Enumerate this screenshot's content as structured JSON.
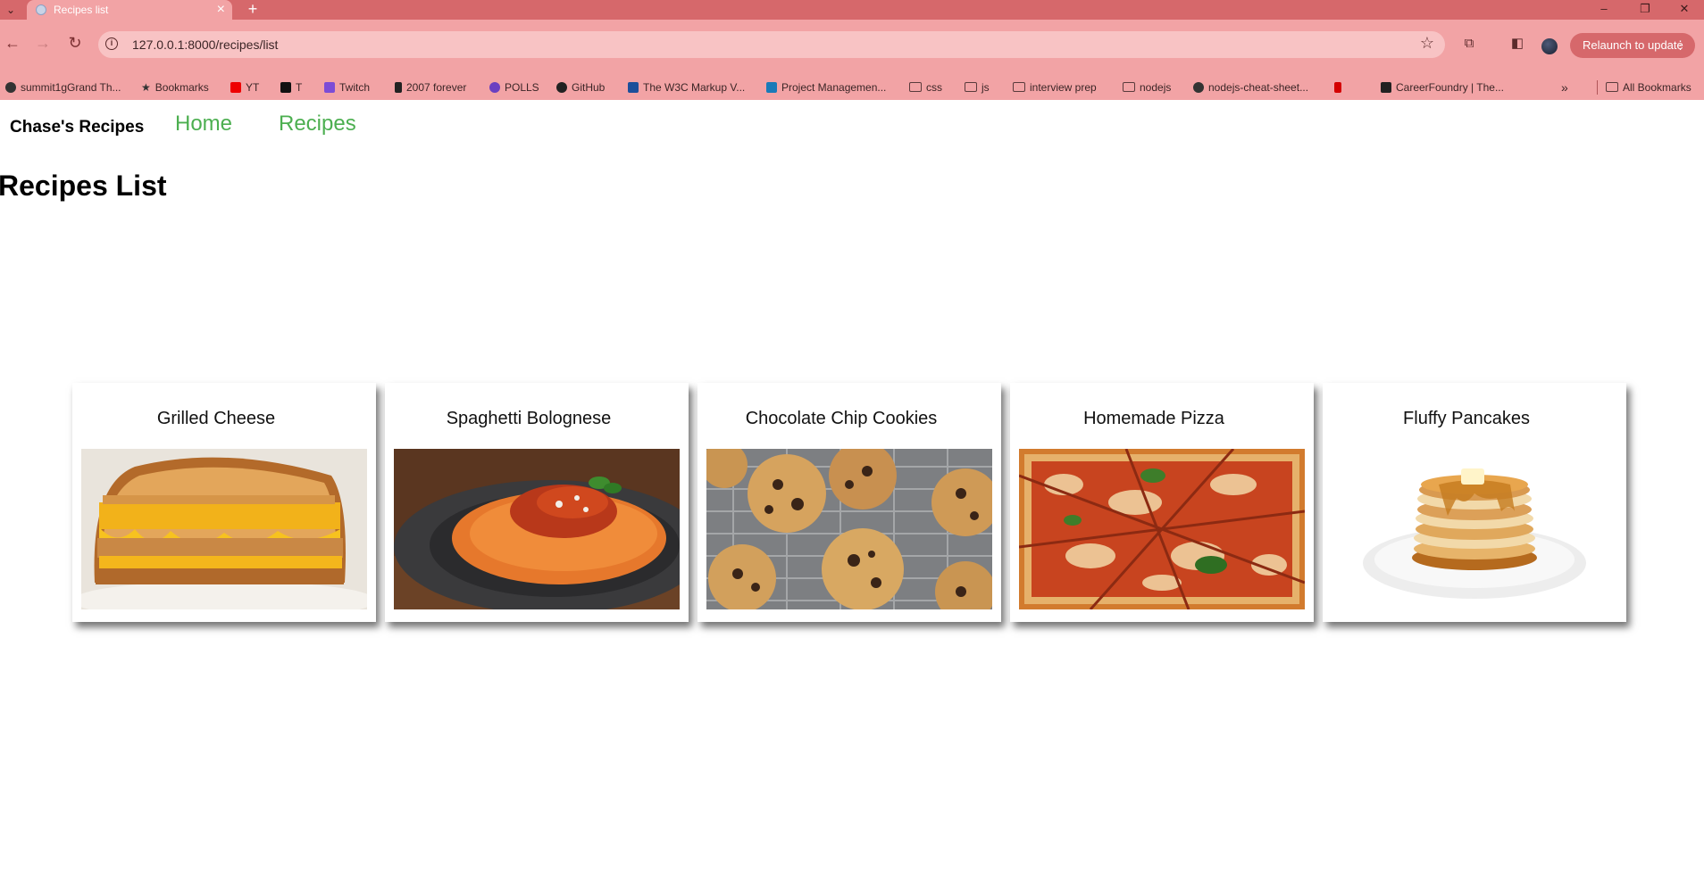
{
  "browser": {
    "tab_title": "Recipes list",
    "new_tab": "+",
    "url": "127.0.0.1:8000/recipes/list",
    "relaunch_label": "Relaunch to update",
    "bookmarks": [
      {
        "label": "summit1gGrand Th...",
        "icon": "globe-icon"
      },
      {
        "label": "Bookmarks",
        "icon": "star-icon"
      },
      {
        "label": "YT",
        "icon": "youtube-icon"
      },
      {
        "label": "T",
        "icon": "x-icon"
      },
      {
        "label": "Twitch",
        "icon": "twitch-icon"
      },
      {
        "label": "2007 forever",
        "icon": "page-icon"
      },
      {
        "label": "POLLS",
        "icon": "polls-icon"
      },
      {
        "label": "GitHub",
        "icon": "github-icon"
      },
      {
        "label": "The W3C Markup V...",
        "icon": "w3c-icon"
      },
      {
        "label": "Project Managemen...",
        "icon": "trello-icon"
      },
      {
        "label": "css",
        "icon": "folder-icon"
      },
      {
        "label": "js",
        "icon": "folder-icon"
      },
      {
        "label": "interview prep",
        "icon": "folder-icon"
      },
      {
        "label": "nodejs",
        "icon": "folder-icon"
      },
      {
        "label": "nodejs-cheat-sheet...",
        "icon": "globe-icon"
      },
      {
        "label": "",
        "icon": "netflix-icon"
      },
      {
        "label": "CareerFoundry | The...",
        "icon": "careerfoundry-icon"
      }
    ],
    "all_bookmarks": "All Bookmarks"
  },
  "site": {
    "brand": "Chase's Recipes",
    "nav": [
      "Home",
      "Recipes"
    ]
  },
  "page": {
    "title": "Recipes List"
  },
  "recipes": [
    {
      "name": "Grilled Cheese"
    },
    {
      "name": "Spaghetti Bolognese"
    },
    {
      "name": "Chocolate Chip Cookies"
    },
    {
      "name": "Homemade Pizza"
    },
    {
      "name": "Fluffy Pancakes"
    }
  ],
  "colors": {
    "chrome_accent": "#d6686b",
    "chrome_bar": "#f2a3a5",
    "nav_link": "#4caf50"
  }
}
